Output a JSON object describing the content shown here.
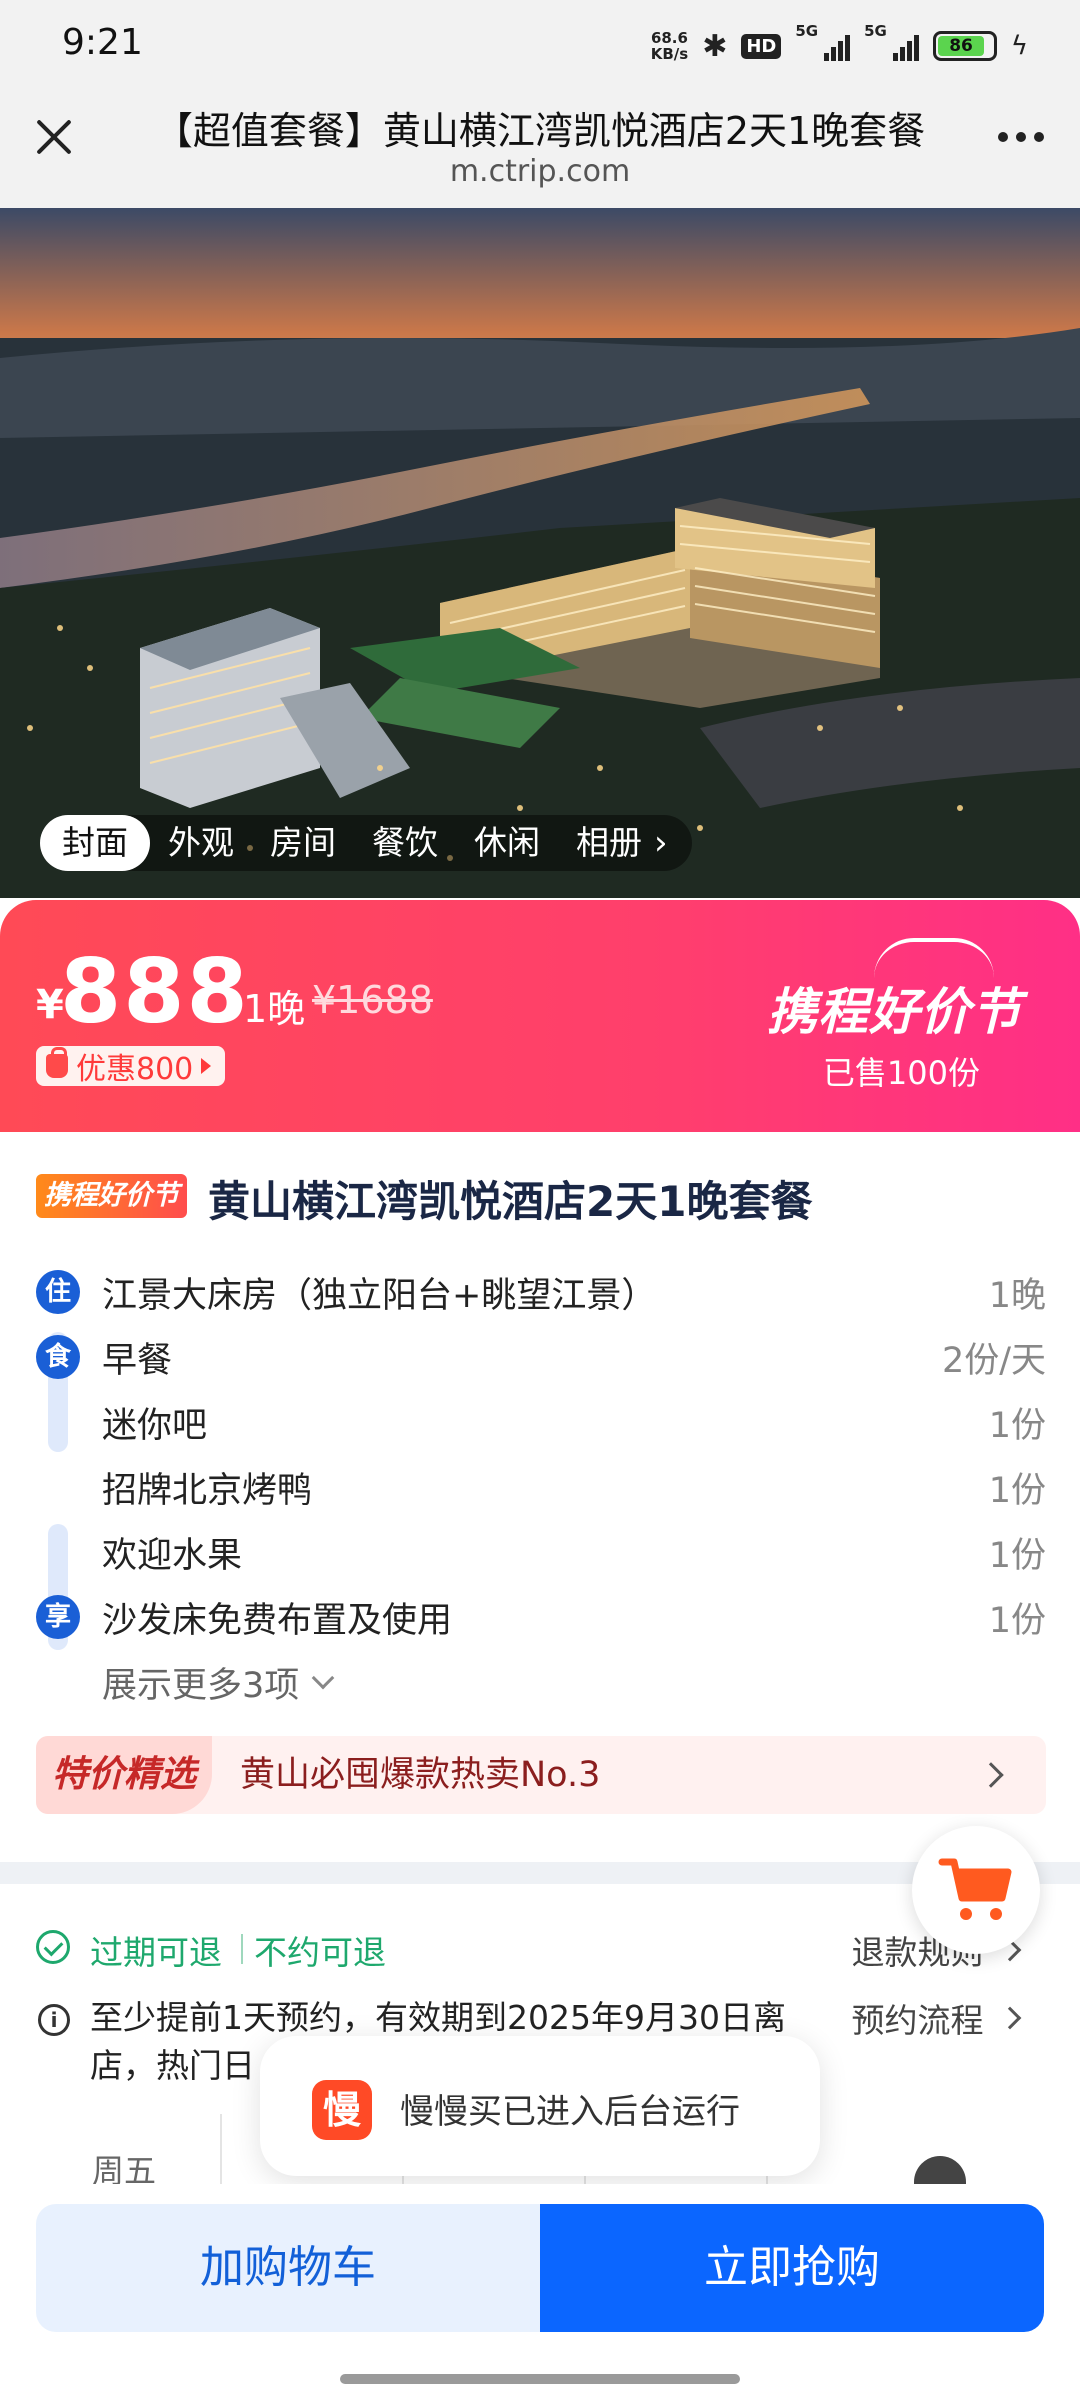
{
  "status_bar": {
    "time": "9:21",
    "net_speed_value": "68.6",
    "net_speed_unit": "KB/s",
    "hd_label": "HD",
    "signal_label": "5G",
    "battery": "86"
  },
  "browser": {
    "title": "【超值套餐】黄山横江湾凯悦酒店2天1晚套餐",
    "url": "m.ctrip.com"
  },
  "gallery": {
    "tabs": [
      "封面",
      "外观",
      "房间",
      "餐饮",
      "休闲"
    ],
    "album_label": "相册"
  },
  "price": {
    "currency": "¥",
    "amount": "888",
    "nights": "1晚",
    "original": "¥1688",
    "discount": "优惠800",
    "festival": "携程好价节",
    "sold": "已售100份"
  },
  "product": {
    "festival_tag": "携程好价节",
    "title": "黄山横江湾凯悦酒店2天1晚套餐",
    "items": [
      {
        "badge": "住",
        "name": "江景大床房（独立阳台+眺望江景）",
        "qty": "1晚"
      },
      {
        "badge": "食",
        "name": "早餐",
        "qty": "2份/天"
      },
      {
        "badge": "",
        "name": "迷你吧",
        "qty": "1份"
      },
      {
        "badge": "",
        "name": "招牌北京烤鸭",
        "qty": "1份"
      },
      {
        "badge": "",
        "name": "欢迎水果",
        "qty": "1份"
      },
      {
        "badge": "享",
        "name": "沙发床免费布置及使用",
        "qty": "1份"
      }
    ],
    "show_more": "展示更多3项",
    "special_tag": "特价精选",
    "special_text": "黄山必囤爆款热卖No.3"
  },
  "policy": {
    "refund_expired": "过期可退",
    "refund_anytime": "不约可退",
    "refund_rule": "退款规则",
    "booking_info": "至少提前1天预约，有效期到2025年9月30日离店，热门日",
    "booking_process": "预约流程",
    "weekday": "周五"
  },
  "toast": {
    "icon_char": "慢",
    "text": "慢慢买已进入后台运行"
  },
  "actions": {
    "add_cart": "加购物车",
    "buy_now": "立即抢购"
  },
  "colors": {
    "brand_blue": "#0b66ff",
    "price_red": "#ff4a56",
    "refund_green": "#1ea86d"
  }
}
